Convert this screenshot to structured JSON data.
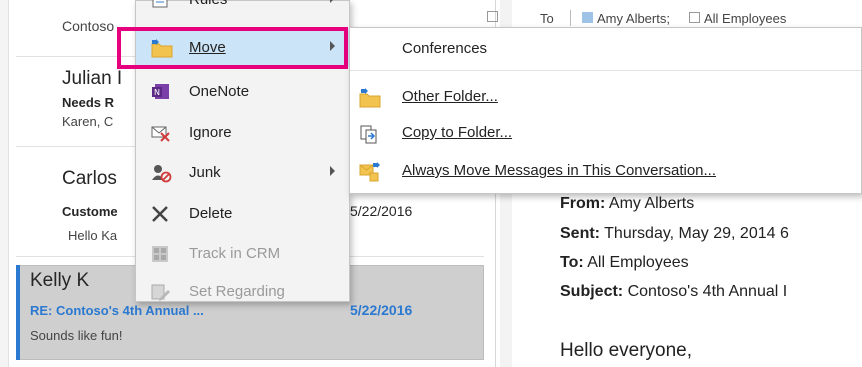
{
  "message_list": {
    "row1": {
      "name": "Contoso"
    },
    "row2": {
      "name": "Julian I",
      "subject": "Needs R",
      "preview": "Karen,  C"
    },
    "row3": {
      "name": "Carlos",
      "subject": "Custome",
      "preview": "Hello Ka",
      "date": "5/22/2016"
    },
    "row4": {
      "name": "Kelly K",
      "subject": "RE: Contoso's 4th Annual ...",
      "preview": "Sounds like fun!",
      "date": "5/22/2016",
      "accent_color": "#2b79d0"
    }
  },
  "reading_pane": {
    "to_label": "To",
    "recipients": [
      "Amy Alberts;",
      "All Employees"
    ],
    "from_label": "From:",
    "from_value": "Amy Alberts",
    "sent_label": "Sent:",
    "sent_value": "Thursday, May 29, 2014 6",
    "to_field_label": "To:",
    "to_field_value": "All Employees",
    "subject_label": "Subject:",
    "subject_value": "Contoso's 4th Annual I",
    "body_start": "Hello everyone,"
  },
  "context_menu": {
    "items": [
      {
        "label": "Rules",
        "icon": "rules-icon",
        "submenu": true,
        "enabled": true
      },
      {
        "label": "Move",
        "icon": "move-folder-icon",
        "submenu": true,
        "enabled": true,
        "highlighted": true
      },
      {
        "label": "OneNote",
        "icon": "onenote-icon",
        "submenu": false,
        "enabled": true
      },
      {
        "label": "Ignore",
        "icon": "ignore-icon",
        "submenu": false,
        "enabled": true
      },
      {
        "label": "Junk",
        "icon": "junk-icon",
        "submenu": true,
        "enabled": true
      },
      {
        "label": "Delete",
        "icon": "delete-icon",
        "submenu": false,
        "enabled": true
      },
      {
        "label": "Track in CRM",
        "icon": "crm-icon",
        "submenu": false,
        "enabled": false
      },
      {
        "label": "Set Regarding",
        "icon": "set-regarding-icon",
        "submenu": false,
        "enabled": false
      }
    ]
  },
  "move_submenu": {
    "items": [
      {
        "label": "Conferences",
        "icon": ""
      },
      {
        "label": "Other Folder...",
        "icon": "folder-move-icon"
      },
      {
        "label": "Copy to Folder...",
        "icon": "copy-folder-icon"
      },
      {
        "label": "Always Move Messages in This Conversation...",
        "icon": "always-move-icon"
      }
    ]
  },
  "colors": {
    "highlight_border": "#e6007e",
    "hover_background": "#cce4f7",
    "selection_background": "#cfcfcf",
    "accent_blue": "#2b79d0"
  }
}
